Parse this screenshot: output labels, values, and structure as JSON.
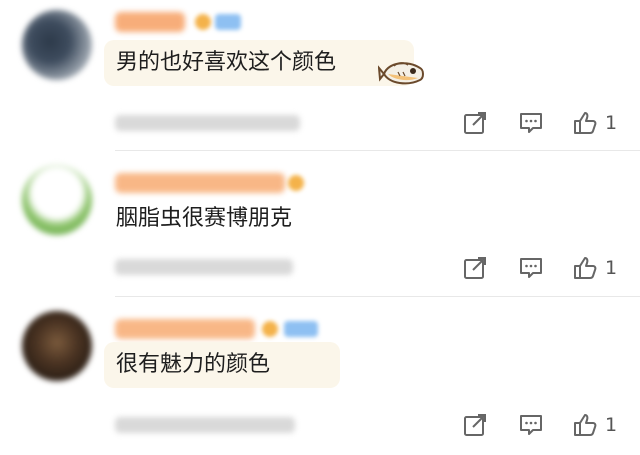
{
  "comments": [
    {
      "text": "男的也好喜欢这个颜色",
      "likes": "1",
      "has_sticker": true,
      "sticker_icon": "fish-sticker-icon"
    },
    {
      "text": "胭脂虫很赛博朋克",
      "likes": "1",
      "has_sticker": false
    },
    {
      "text": "很有魅力的颜色",
      "likes": "1",
      "has_sticker": false
    }
  ],
  "colors": {
    "name_orange": "#f6a35a",
    "bubble": "#fbf6ea",
    "icon_gray": "#666666"
  }
}
